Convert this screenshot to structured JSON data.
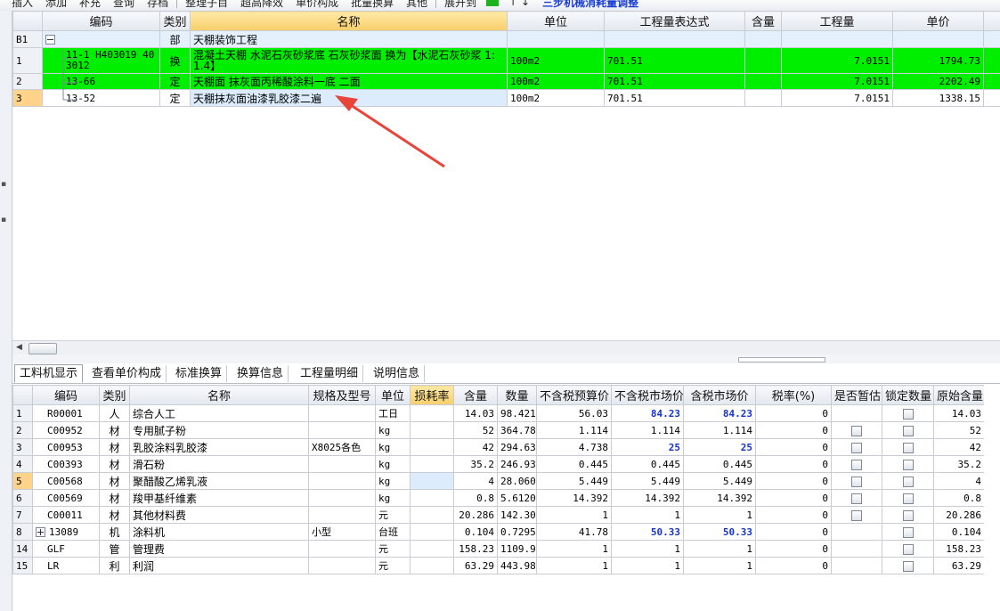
{
  "toolbar": {
    "items": [
      "插入",
      "添加",
      "补充",
      "查询",
      "存档",
      "整理子目",
      "超高降效",
      "单价构成",
      "批量换算",
      "其他",
      "展开到"
    ],
    "highlight": "三步机械消耗量调整"
  },
  "upper": {
    "headers": {
      "code": "编码",
      "cat": "类别",
      "name": "名称",
      "unit": "单位",
      "expr": "工程量表达式",
      "content": "含量",
      "qty": "工程量",
      "price": "单价"
    },
    "rows": [
      {
        "idx": "B1",
        "code": "",
        "cat": "部",
        "name": "天棚装饰工程",
        "unit": "",
        "expr": "",
        "content": "",
        "qty": "",
        "price": ""
      },
      {
        "idx": "1",
        "code": "11-1 H403019 40",
        "code2": "3012",
        "cat": "换",
        "name": "混凝土天棚 水泥石灰砂浆底 石灰砂浆面 换为【水泥石灰砂浆 1:",
        "name2": "1.4】",
        "unit": "100m2",
        "expr": "701.51",
        "content": "",
        "qty": "7.0151",
        "price": "1794.73"
      },
      {
        "idx": "2",
        "code": "13-66",
        "cat": "定",
        "name": "天棚面 抹灰面丙稀酸涂料一底 二面",
        "unit": "100m2",
        "expr": "701.51",
        "content": "",
        "qty": "7.0151",
        "price": "2202.49"
      },
      {
        "idx": "3",
        "code": "13-52",
        "cat": "定",
        "name": "天棚抹灰面油漆乳胶漆二遍",
        "unit": "100m2",
        "expr": "701.51",
        "content": "",
        "qty": "7.0151",
        "price": "1338.15"
      }
    ]
  },
  "tabs": [
    "工料机显示",
    "查看单价构成",
    "标准换算",
    "换算信息",
    "工程量明细",
    "说明信息"
  ],
  "lower": {
    "headers": {
      "code": "编码",
      "cat": "类别",
      "name": "名称",
      "spec": "规格及型号",
      "unit": "单位",
      "loss": "损耗率",
      "content": "含量",
      "qty": "数量",
      "p1": "不含税预算价",
      "p2": "不含税市场价",
      "p3": "含税市场价",
      "tax": "税率(%)",
      "temp": "是否暂估",
      "lock": "锁定数量",
      "orig": "原始含量"
    },
    "rows": [
      {
        "idx": "1",
        "code": "R00001",
        "cat": "人",
        "name": "综合人工",
        "spec": "",
        "unit": "工日",
        "content": "14.03",
        "qty": "98.4218",
        "p1": "56.03",
        "p2": "84.23",
        "p3": "84.23",
        "tax": "0",
        "temp": false,
        "orig": "14.03"
      },
      {
        "idx": "2",
        "code": "C00952",
        "cat": "材",
        "name": "专用腻子粉",
        "spec": "",
        "unit": "kg",
        "content": "52",
        "qty": "364.785",
        "p1": "1.114",
        "p2": "1.114",
        "p3": "1.114",
        "tax": "0",
        "temp": true,
        "orig": "52"
      },
      {
        "idx": "3",
        "code": "C00953",
        "cat": "材",
        "name": "乳胶涂料乳胶漆",
        "spec": "X8025各色",
        "unit": "kg",
        "content": "42",
        "qty": "294.634",
        "p1": "4.738",
        "p2": "25",
        "p3": "25",
        "tax": "0",
        "temp": true,
        "orig": "42"
      },
      {
        "idx": "4",
        "code": "C00393",
        "cat": "材",
        "name": "滑石粉",
        "spec": "",
        "unit": "kg",
        "content": "35.2",
        "qty": "246.931",
        "p1": "0.445",
        "p2": "0.445",
        "p3": "0.445",
        "tax": "0",
        "temp": true,
        "orig": "35.2"
      },
      {
        "idx": "5",
        "code": "C00568",
        "cat": "材",
        "name": "聚醋酸乙烯乳液",
        "spec": "",
        "unit": "kg",
        "content": "4",
        "qty": "28.0604",
        "p1": "5.449",
        "p2": "5.449",
        "p3": "5.449",
        "tax": "0",
        "temp": true,
        "orig": "4"
      },
      {
        "idx": "6",
        "code": "C00569",
        "cat": "材",
        "name": "羧甲基纤维素",
        "spec": "",
        "unit": "kg",
        "content": "0.8",
        "qty": "5.61208",
        "p1": "14.392",
        "p2": "14.392",
        "p3": "14.392",
        "tax": "0",
        "temp": true,
        "orig": "0.8"
      },
      {
        "idx": "7",
        "code": "C00011",
        "cat": "材",
        "name": "其他材料费",
        "spec": "",
        "unit": "元",
        "content": "20.286",
        "qty": "142.308",
        "p1": "1",
        "p2": "1",
        "p3": "1",
        "tax": "0",
        "temp": true,
        "orig": "20.286"
      },
      {
        "idx": "8",
        "code": "13089",
        "cat": "机",
        "name": "涂料机",
        "spec": "小型",
        "unit": "台班",
        "content": "0.104",
        "qty": "0.72957",
        "p1": "41.78",
        "p2": "50.33",
        "p3": "50.33",
        "tax": "0",
        "temp": false,
        "orig": "0.104"
      },
      {
        "idx": "14",
        "code": "GLF",
        "cat": "管",
        "name": "管理费",
        "spec": "",
        "unit": "元",
        "content": "158.23",
        "qty": "1109.99",
        "p1": "1",
        "p2": "1",
        "p3": "1",
        "tax": "0",
        "temp": false,
        "orig": "158.23"
      },
      {
        "idx": "15",
        "code": "LR",
        "cat": "利",
        "name": "利润",
        "spec": "",
        "unit": "元",
        "content": "63.29",
        "qty": "443.985",
        "p1": "1",
        "p2": "1",
        "p3": "1",
        "tax": "0",
        "temp": false,
        "orig": "63.29"
      }
    ]
  },
  "colors": {
    "green_row": "#00ee00",
    "selection": "#dcecfd",
    "arrow": "#e8443a",
    "blue_value": "#1533c8"
  }
}
